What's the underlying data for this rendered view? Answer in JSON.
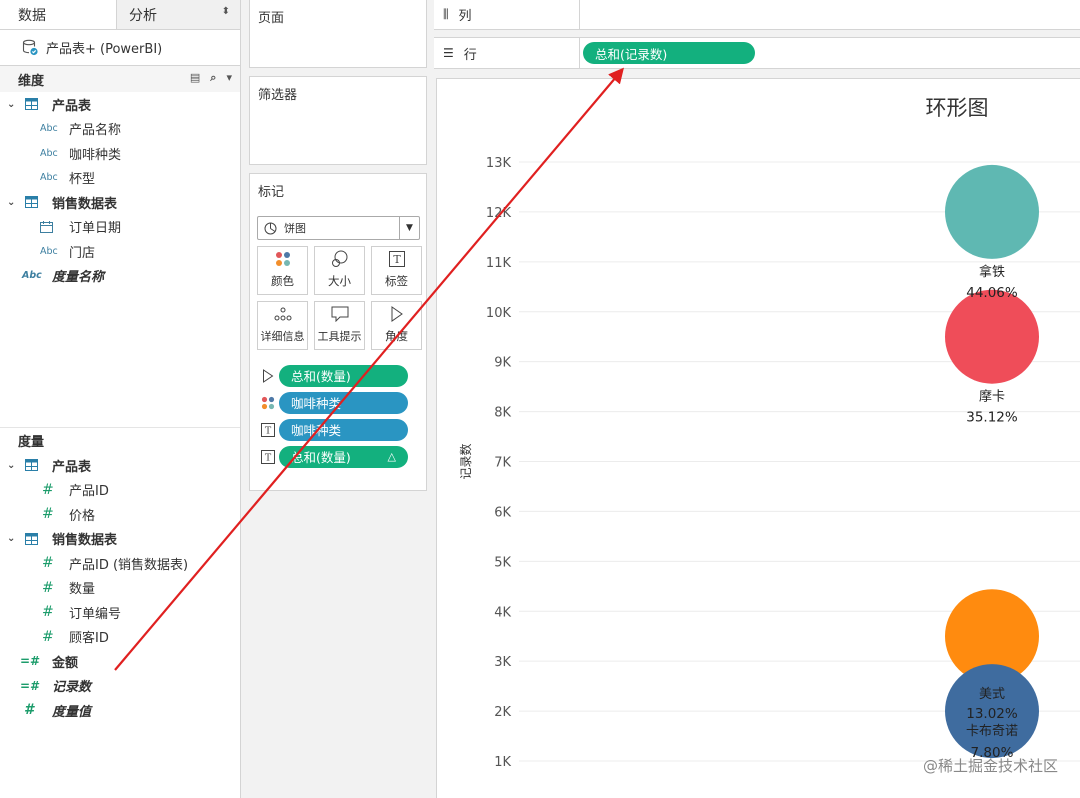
{
  "data_pane": {
    "tab_data": "数据",
    "tab_analysis": "分析",
    "datasource": "产品表+ (PowerBI)",
    "dimensions_header": "维度",
    "dimensions": [
      {
        "kind": "table",
        "label": "产品表"
      },
      {
        "kind": "field",
        "type": "Abc",
        "label": "产品名称"
      },
      {
        "kind": "field",
        "type": "Abc",
        "label": "咖啡种类"
      },
      {
        "kind": "field",
        "type": "Abc",
        "label": "杯型"
      },
      {
        "kind": "table",
        "label": "销售数据表"
      },
      {
        "kind": "field",
        "type": "date",
        "label": "订单日期"
      },
      {
        "kind": "field",
        "type": "Abc",
        "label": "门店"
      },
      {
        "kind": "root",
        "type": "Abc",
        "label": "度量名称"
      }
    ],
    "measures_header": "度量",
    "measures": [
      {
        "kind": "table",
        "label": "产品表"
      },
      {
        "kind": "field",
        "type": "#",
        "label": "产品ID"
      },
      {
        "kind": "field",
        "type": "#",
        "label": "价格"
      },
      {
        "kind": "table",
        "label": "销售数据表"
      },
      {
        "kind": "field",
        "type": "#",
        "label": "产品ID (销售数据表)"
      },
      {
        "kind": "field",
        "type": "#",
        "label": "数量"
      },
      {
        "kind": "field",
        "type": "#",
        "label": "订单编号"
      },
      {
        "kind": "field",
        "type": "#",
        "label": "顾客ID"
      },
      {
        "kind": "root-plain",
        "type": "calc",
        "label": "金额"
      },
      {
        "kind": "root",
        "type": "calc",
        "label": "记录数"
      },
      {
        "kind": "root",
        "type": "#",
        "label": "度量值"
      }
    ]
  },
  "shelves": {
    "pages_title": "页面",
    "filters_title": "筛选器",
    "marks_title": "标记",
    "mark_type": "饼图",
    "mark_buttons": [
      {
        "id": "color",
        "label": "颜色"
      },
      {
        "id": "size",
        "label": "大小"
      },
      {
        "id": "label",
        "label": "标签"
      },
      {
        "id": "detail",
        "label": "详细信息"
      },
      {
        "id": "tooltip",
        "label": "工具提示"
      },
      {
        "id": "angle",
        "label": "角度"
      }
    ],
    "mark_pills": [
      {
        "icon": "angle",
        "label": "总和(数量)",
        "color": "green",
        "delta": ""
      },
      {
        "icon": "color",
        "label": "咖啡种类",
        "color": "blue",
        "delta": ""
      },
      {
        "icon": "text",
        "label": "咖啡种类",
        "color": "blue",
        "delta": ""
      },
      {
        "icon": "text",
        "label": "总和(数量)",
        "color": "green",
        "delta": "△"
      }
    ]
  },
  "canvas": {
    "columns_label": "列",
    "rows_label": "行",
    "rows_pill": "总和(记录数)"
  },
  "chart_data": {
    "type": "scatter",
    "title": "环形图",
    "ylabel": "记录数",
    "xlabel": "",
    "ylim": [
      0,
      13500
    ],
    "y_ticks": [
      1000,
      2000,
      3000,
      4000,
      5000,
      6000,
      7000,
      8000,
      9000,
      10000,
      11000,
      12000,
      13000
    ],
    "y_tick_labels": [
      "1K",
      "2K",
      "3K",
      "4K",
      "5K",
      "6K",
      "7K",
      "8K",
      "9K",
      "10K",
      "11K",
      "12K",
      "13K"
    ],
    "grid": true,
    "points": [
      {
        "name": "拿铁",
        "pct": "44.06%",
        "y": 12000,
        "color": "#5fb8b2"
      },
      {
        "name": "摩卡",
        "pct": "35.12%",
        "y": 9500,
        "color": "#ef4d59"
      },
      {
        "name": "美式",
        "pct": "13.02%",
        "y": 2000,
        "color": "#3f6c9f"
      },
      {
        "name": "卡布奇诺",
        "pct": "7.80%",
        "y": 3500,
        "color": "#ff8b0f"
      }
    ]
  },
  "watermark": "@稀土掘金技术社区",
  "colors": {
    "pill_green": "#13b07e",
    "pill_blue": "#2a95c2",
    "annotation_arrow": "#e02020"
  }
}
